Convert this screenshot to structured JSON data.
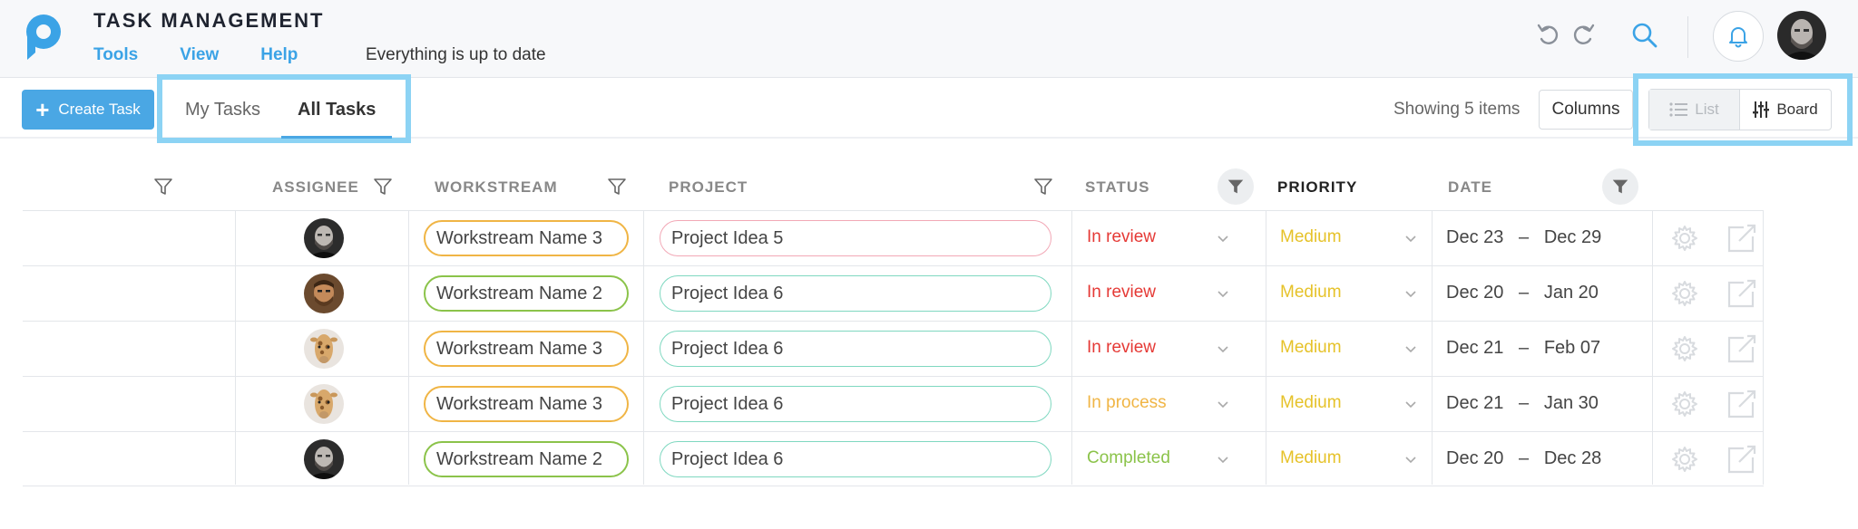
{
  "header": {
    "title": "TASK MANAGEMENT",
    "menu": [
      {
        "label": "Tools"
      },
      {
        "label": "View"
      },
      {
        "label": "Help"
      }
    ],
    "sync_status": "Everything is up to date",
    "icons": [
      "undo-icon",
      "redo-icon",
      "search-icon",
      "bell-icon",
      "user-avatar"
    ]
  },
  "toolbar": {
    "create_label": "Create Task",
    "tabs": [
      {
        "label": "My Tasks",
        "active": false
      },
      {
        "label": "All Tasks",
        "active": true
      }
    ],
    "showing": "Showing 5 items",
    "columns_label": "Columns",
    "views": [
      {
        "label": "List",
        "active": false
      },
      {
        "label": "Board",
        "active": true
      }
    ]
  },
  "table": {
    "headers": {
      "assignee": "ASSIGNEE",
      "workstream": "WORKSTREAM",
      "project": "PROJECT",
      "status": "STATUS",
      "priority": "PRIORITY",
      "date": "DATE"
    },
    "rows": [
      {
        "avatar": "man",
        "workstream": "Workstream Name 3",
        "ws_color": "#f0b545",
        "project": "Project Idea 5",
        "proj_color": "#f2a8b6",
        "status": "In review",
        "status_color": "#e53935",
        "priority": "Medium",
        "date_start": "Dec 23",
        "date_end": "Dec 29"
      },
      {
        "avatar": "man2",
        "workstream": "Workstream Name 2",
        "ws_color": "#8bc34a",
        "project": "Project Idea 6",
        "proj_color": "#7fd8c0",
        "status": "In review",
        "status_color": "#e53935",
        "priority": "Medium",
        "date_start": "Dec 20",
        "date_end": "Jan 20"
      },
      {
        "avatar": "giraffe",
        "workstream": "Workstream Name 3",
        "ws_color": "#f0b545",
        "project": "Project Idea 6",
        "proj_color": "#7fd8c0",
        "status": "In review",
        "status_color": "#e53935",
        "priority": "Medium",
        "date_start": "Dec 21",
        "date_end": "Feb 07"
      },
      {
        "avatar": "giraffe",
        "workstream": "Workstream Name 3",
        "ws_color": "#f0b545",
        "project": "Project Idea 6",
        "proj_color": "#7fd8c0",
        "status": "In process",
        "status_color": "#f0b545",
        "priority": "Medium",
        "date_start": "Dec 21",
        "date_end": "Jan 30"
      },
      {
        "avatar": "man",
        "workstream": "Workstream Name 2",
        "ws_color": "#8bc34a",
        "project": "Project Idea 6",
        "proj_color": "#7fd8c0",
        "status": "Completed",
        "status_color": "#8bc34a",
        "priority": "Medium",
        "date_start": "Dec 20",
        "date_end": "Dec 28"
      }
    ]
  },
  "colors": {
    "accent": "#4aa7e4",
    "highlight": "#8cd3f4",
    "priority_medium": "#e6c229"
  }
}
